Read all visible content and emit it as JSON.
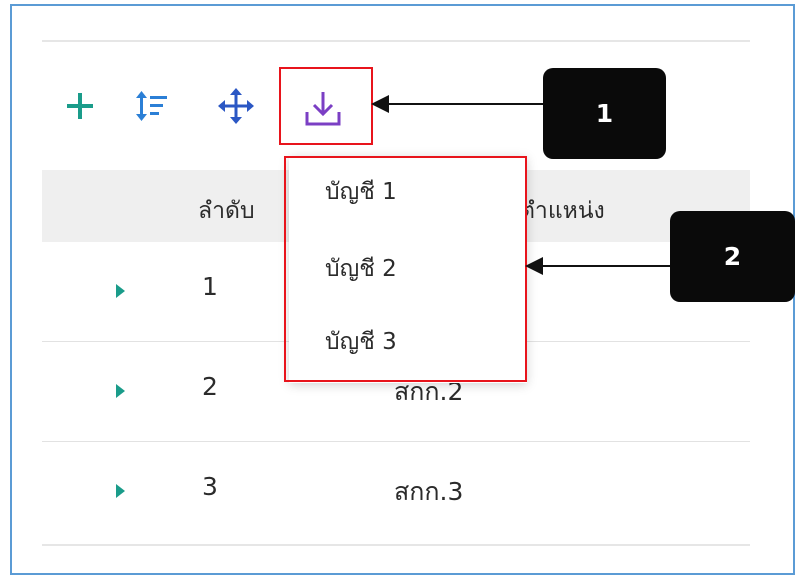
{
  "toolbar": {
    "add_icon": "plus-icon",
    "sort_icon": "sort-icon",
    "move_icon": "move-icon",
    "download_icon": "download-icon"
  },
  "table": {
    "headers": [
      "ลำดับ",
      "ตำแหน่ง"
    ],
    "rows": [
      {
        "order": "1",
        "position": ""
      },
      {
        "order": "2",
        "position": "สกก.2"
      },
      {
        "order": "3",
        "position": "สกก.3"
      }
    ]
  },
  "dropdown": {
    "items": [
      "บัญชี 1",
      "บัญชี 2",
      "บัญชี 3"
    ]
  },
  "callouts": [
    "1",
    "2"
  ],
  "colors": {
    "accent_teal": "#1a9c8a",
    "accent_blue": "#2b57c4",
    "accent_purple": "#7b3fc4",
    "highlight_red": "#e8141c",
    "frame_blue": "#5b9bd5"
  }
}
